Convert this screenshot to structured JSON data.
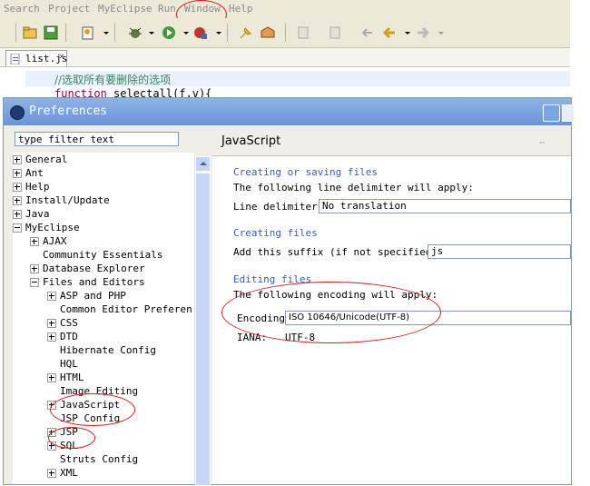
{
  "menubar": {
    "items": [
      "Search",
      "Project",
      "MyEclipse",
      "Run",
      "Window",
      "Help"
    ]
  },
  "editor": {
    "tab_label": "list.js",
    "close_glyph": "×",
    "line1": "//选取所有要删除的选项",
    "line2_keyword": "function",
    "line2_rest": " selectall(f,v){"
  },
  "dialog": {
    "title": "Preferences",
    "filter_placeholder": "type filter text",
    "tree": [
      {
        "label": "General",
        "level": 0,
        "toggle": "plus"
      },
      {
        "label": "Ant",
        "level": 0,
        "toggle": "plus"
      },
      {
        "label": "Help",
        "level": 0,
        "toggle": "plus"
      },
      {
        "label": "Install/Update",
        "level": 0,
        "toggle": "plus"
      },
      {
        "label": "Java",
        "level": 0,
        "toggle": "plus"
      },
      {
        "label": "MyEclipse",
        "level": 0,
        "toggle": "minus"
      },
      {
        "label": "AJAX",
        "level": 1,
        "toggle": "plus"
      },
      {
        "label": "Community Essentials",
        "level": 1,
        "toggle": "none"
      },
      {
        "label": "Database Explorer",
        "level": 1,
        "toggle": "plus"
      },
      {
        "label": "Files and Editors",
        "level": 1,
        "toggle": "minus"
      },
      {
        "label": "ASP and PHP",
        "level": 2,
        "toggle": "plus"
      },
      {
        "label": "Common Editor Preferen",
        "level": 2,
        "toggle": "none"
      },
      {
        "label": "CSS",
        "level": 2,
        "toggle": "plus"
      },
      {
        "label": "DTD",
        "level": 2,
        "toggle": "plus"
      },
      {
        "label": "Hibernate Config",
        "level": 2,
        "toggle": "none"
      },
      {
        "label": "HQL",
        "level": 2,
        "toggle": "none"
      },
      {
        "label": "HTML",
        "level": 2,
        "toggle": "plus"
      },
      {
        "label": "Image Editing",
        "level": 2,
        "toggle": "none"
      },
      {
        "label": "JavaScript",
        "level": 2,
        "toggle": "plus"
      },
      {
        "label": "JSP Config",
        "level": 2,
        "toggle": "none"
      },
      {
        "label": "JSP",
        "level": 2,
        "toggle": "plus"
      },
      {
        "label": "SQL",
        "level": 2,
        "toggle": "plus"
      },
      {
        "label": "Struts Config",
        "level": 2,
        "toggle": "none"
      },
      {
        "label": "XML",
        "level": 2,
        "toggle": "plus"
      }
    ],
    "page_title": "JavaScript",
    "nav_back": "⇦",
    "sections": {
      "creating_saving": "Creating or saving files",
      "delimiter_text": "The following line delimiter will apply:",
      "delimiter_label": "Line delimiter:",
      "delimiter_value": "No translation",
      "creating": "Creating files",
      "suffix_label": "Add this suffix (if not specified):",
      "suffix_value": "js",
      "editing": "Editing files",
      "encoding_text": "The following encoding will apply:",
      "encoding_label": "Encoding",
      "encoding_value": "ISO 10646/Unicode(UTF-8)",
      "iana_label": "IANA:",
      "iana_value": "UTF-8"
    }
  }
}
